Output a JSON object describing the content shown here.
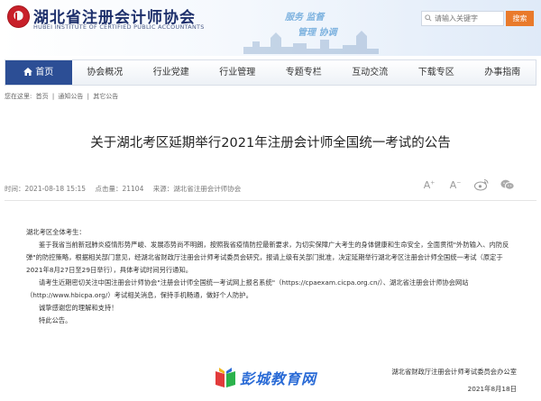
{
  "header": {
    "title": "湖北省注册会计师协会",
    "subtitle": "HUBEI INSTITUTE OF CERTIFIED PUBLIC ACCOUNTANTS",
    "slogan_line1": "服务  监督",
    "slogan_line2": "管理  协调"
  },
  "search": {
    "placeholder": "请输入关键字",
    "button_label": "搜索"
  },
  "nav": {
    "items": [
      {
        "label": "首页"
      },
      {
        "label": "协会概况"
      },
      {
        "label": "行业党建"
      },
      {
        "label": "行业管理"
      },
      {
        "label": "专题专栏"
      },
      {
        "label": "互动交流"
      },
      {
        "label": "下载专区"
      },
      {
        "label": "办事指南"
      }
    ]
  },
  "breadcrumb": {
    "prefix": "您在这里:",
    "items": [
      "首页",
      "通知公告",
      "其它公告"
    ],
    "separator": "|"
  },
  "article": {
    "title": "关于湖北考区延期举行2021年注册会计师全国统一考试的公告",
    "meta": {
      "time": "时间：2021-08-18 15:15",
      "hits": "点击量：21104",
      "source": "来源：湖北省注册会计师协会"
    },
    "tools": {
      "font_increase": "A",
      "font_decrease": "A"
    },
    "greeting": "湖北考区全体考生：",
    "paragraphs": [
      "鉴于我省当前新冠肺炎疫情形势严峻、发展态势尚不明朗，按照我省疫情防控最新要求，为切实保障广大考生的身体健康和生命安全，全面贯彻\"外防输入、内防反弹\"的防控策略，根据相关部门意见，经湖北省财政厅注册会计师考试委员会研究，报请上级有关部门批准，决定延期举行湖北考区注册会计师全国统一考试（原定于2021年8月27日至29日举行），具体考试时间另行通知。",
      "请考生近期密切关注中国注册会计师协会\"注册会计师全国统一考试网上报名系统\"（https://cpaexam.cicpa.org.cn/）、湖北省注册会计师协会网站（http://www.hbicpa.org/）考试相关消息，保持手机畅通，做好个人防护。",
      "诚挚感谢您的理解和支持！",
      "特此公告。"
    ],
    "signature_org": "湖北省财政厅注册会计师考试委员会办公室",
    "signature_date": "2021年8月18日"
  },
  "watermark": {
    "text": "彭城教育网"
  },
  "colors": {
    "nav_active": "#2c4e95",
    "search_button": "#e97a2b",
    "title_blue": "#1d2f6b",
    "watermark_blue": "#2a6bd6"
  }
}
